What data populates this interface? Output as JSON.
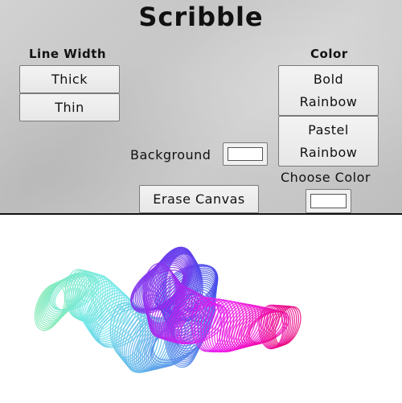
{
  "app": {
    "title": "Scribble"
  },
  "line_width": {
    "label": "Line Width",
    "thick_label": "Thick",
    "thin_label": "Thin"
  },
  "color": {
    "label": "Color",
    "bold_rainbow_label": "Bold Rainbow",
    "pastel_rainbow_label": "Pastel Rainbow",
    "choose_color_label": "Choose Color",
    "choose_color_value": "#ffffff"
  },
  "background": {
    "label": "Background",
    "value": "#ffffff"
  },
  "erase": {
    "label": "Erase Canvas"
  },
  "colors": {
    "toolbar_bg": "#c9c9c9",
    "canvas_bg": "#ffffff",
    "border": "#111111"
  },
  "canvas": {
    "drawing": "rainbow-spiral-scribble"
  }
}
